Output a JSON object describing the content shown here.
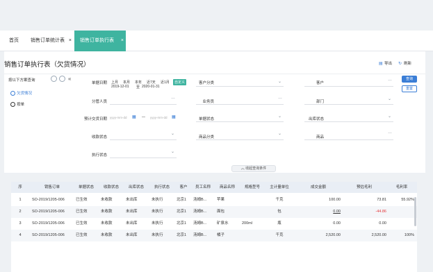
{
  "tabs": [
    {
      "label": "首页"
    },
    {
      "label": "销售订单统计表",
      "close": "×"
    },
    {
      "label": "销售订单执行表",
      "close": "×"
    }
  ],
  "page": {
    "title": "销售订单执行表（欠货情况）",
    "export_label": "导出",
    "refresh_label": "刷新"
  },
  "scheme": {
    "label": "按以下方案查询",
    "items": [
      {
        "label": "欠货情况"
      },
      {
        "label": "按单"
      }
    ]
  },
  "filters": {
    "order_date": "单据日期",
    "presets": [
      "上月",
      "本月",
      "本年",
      "近7天",
      "近1月",
      "自定义"
    ],
    "date_start": "2019-12-01",
    "date_sep": "至",
    "date_end": "2020-01-31",
    "customer_category": "客户分类",
    "customer": "客户",
    "salesperson": "业务员",
    "dept": "部门",
    "division_person": "分管人员",
    "expected_delivery": "预计交货日期",
    "range_sep": "—",
    "date_placeholder": "yyyy-mm-dd",
    "order_status": "单据状态",
    "outbound_status": "出库状态",
    "receipt_status": "收款状态",
    "product_category": "商品分类",
    "product": "商品",
    "exec_status": "执行状态"
  },
  "buttons": {
    "query": "查询",
    "reset": "重置",
    "collapse": "收起查询条件"
  },
  "table": {
    "headers": [
      "序",
      "销售订单",
      "单据状态",
      "收款状态",
      "出库状态",
      "执行状态",
      "客户",
      "员工名称",
      "商品名称",
      "规格型号",
      "主计量单位",
      "成交金额",
      "预估毛利",
      "毛利率"
    ],
    "rows": [
      [
        "1",
        "SO-2019/1205-006",
        "已生效",
        "未收款",
        "未出库",
        "未执行",
        "北京1",
        "汤姆B...",
        "苹果",
        "",
        "千克",
        "100.00",
        "73.81",
        "55.92%"
      ],
      [
        "2",
        "SO-2019/1205-006",
        "已生效",
        "未收款",
        "未出库",
        "未执行",
        "北京1",
        "汤姆B...",
        "面包",
        "",
        "包",
        "0.00",
        "-44.86",
        ""
      ],
      [
        "3",
        "SO-2019/1205-006",
        "已生效",
        "未收款",
        "未出库",
        "未执行",
        "北京1",
        "汤姆B...",
        "矿泉水",
        "200ml",
        "瓶",
        "0.00",
        "0.00",
        ""
      ],
      [
        "4",
        "SO-2019/1205-006",
        "已生效",
        "未收款",
        "未出库",
        "未执行",
        "北京1",
        "汤姆B...",
        "橘子",
        "",
        "千克",
        "2,520.00",
        "2,520.00",
        "100%"
      ]
    ]
  },
  "colors": {
    "accent": "#3fb4a0",
    "primary": "#3b7ed6",
    "negative": "#e4393c"
  }
}
